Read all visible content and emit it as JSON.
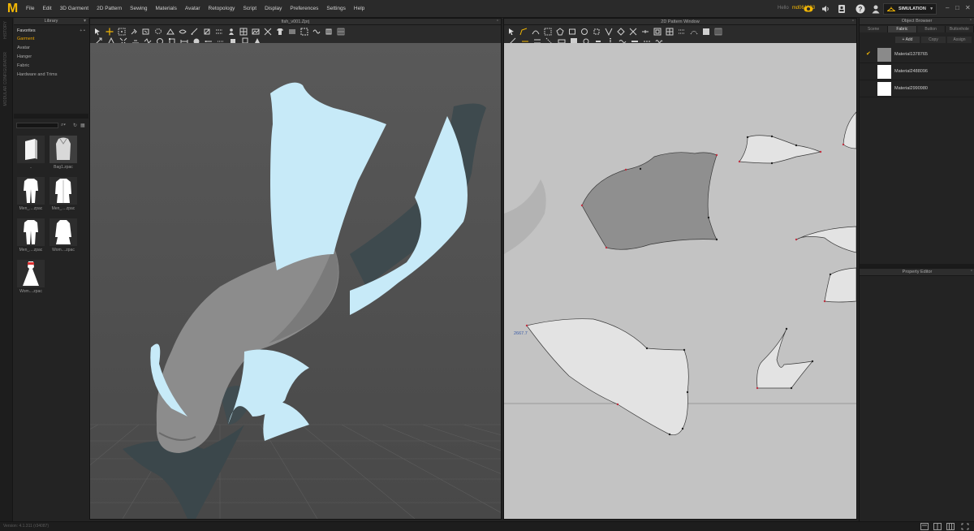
{
  "menubar": {
    "logo_text": "M",
    "items": [
      "File",
      "Edit",
      "3D Garment",
      "2D Pattern",
      "Sewing",
      "Materials",
      "Avatar",
      "Retopology",
      "Script",
      "Display",
      "Preferences",
      "Settings",
      "Help"
    ],
    "user_label": "Hello",
    "username": "md061333",
    "mode_button": "SIMULATION",
    "icons": [
      "cloud-icon",
      "volume-icon",
      "profile-icon",
      "help-icon",
      "user-icon"
    ]
  },
  "left_strip": {
    "tab1": "HISTORY",
    "tab2": "MODULAR CONFIGURATOR"
  },
  "library": {
    "title": "Library",
    "favorites_label": "Favorites",
    "categories": [
      {
        "label": "Garment",
        "active": true
      },
      {
        "label": "Avatar",
        "active": false
      },
      {
        "label": "Hanger",
        "active": false
      },
      {
        "label": "Fabric",
        "active": false
      },
      {
        "label": "Hardware and Trims",
        "active": false
      }
    ],
    "search_placeholder": "",
    "items": [
      {
        "name": "..",
        "kind": "folder"
      },
      {
        "name": "Bag1.zpac",
        "kind": "bag"
      },
      {
        "name": "Men_....zpac",
        "kind": "suit"
      },
      {
        "name": "Men_....zpac",
        "kind": "coat"
      },
      {
        "name": "Men_....zpac",
        "kind": "suit"
      },
      {
        "name": "Wom....zpac",
        "kind": "coat"
      },
      {
        "name": "Wom....zpac",
        "kind": "dress"
      }
    ]
  },
  "window3d": {
    "title": "fish_v001.Zprj"
  },
  "window2d": {
    "title": "2D Pattern Window",
    "measurement": "2667.7"
  },
  "object_browser": {
    "title": "Object Browser",
    "tabs": [
      {
        "label": "Scene",
        "active": false
      },
      {
        "label": "Fabric",
        "active": true
      },
      {
        "label": "Button",
        "active": false
      },
      {
        "label": "Buttonhole",
        "active": false
      }
    ],
    "actions": [
      {
        "label": "+ Add",
        "enabled": true
      },
      {
        "label": "Copy",
        "enabled": false
      },
      {
        "label": "Assign",
        "enabled": false
      }
    ],
    "materials": [
      {
        "name": "Material1378765",
        "color": "#8a8a8a",
        "checked": true
      },
      {
        "name": "Material2488096",
        "color": "#ffffff",
        "checked": false
      },
      {
        "name": "Material2990980",
        "color": "#ffffff",
        "checked": false
      }
    ]
  },
  "property_editor": {
    "title": "Property Editor"
  },
  "status": {
    "version": "Version: 4.1.311 (r34087)"
  },
  "colors": {
    "accent": "#f2b705",
    "fabric_light": "#c7eaf8",
    "fabric_dark": "#3e4a4e",
    "avatar": "#8c8c8c",
    "pattern_dark": "#8f8f8f",
    "pattern_light": "#e3e3e3"
  }
}
